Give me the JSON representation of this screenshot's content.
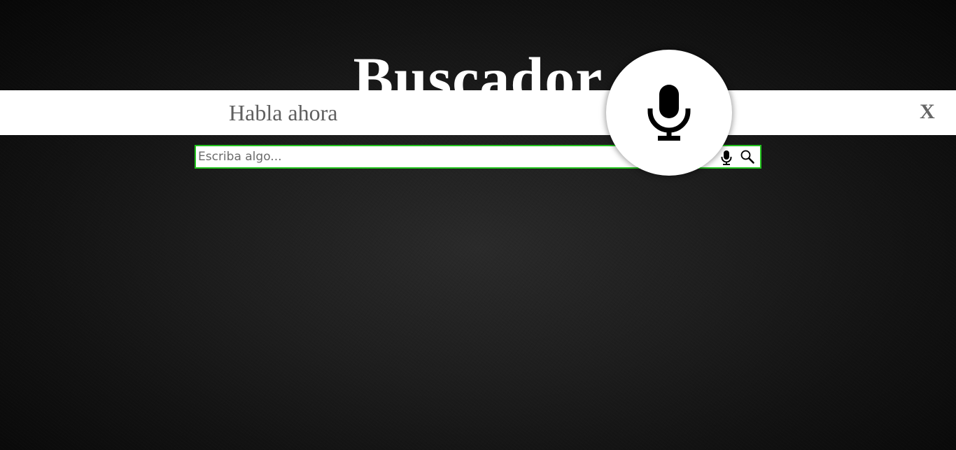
{
  "page": {
    "title": "Buscador"
  },
  "search": {
    "placeholder": "Escriba algo...",
    "value": "",
    "mic_icon": "microphone-icon",
    "search_icon": "magnifier-icon",
    "border_color": "#22c21d"
  },
  "voice_overlay": {
    "prompt": "Habla ahora",
    "close_label": "X",
    "mic_icon": "microphone-icon"
  },
  "colors": {
    "background": "#151515",
    "title": "#ffffff",
    "overlay_bar": "#ffffff",
    "prompt_text": "#5f5f5f"
  }
}
